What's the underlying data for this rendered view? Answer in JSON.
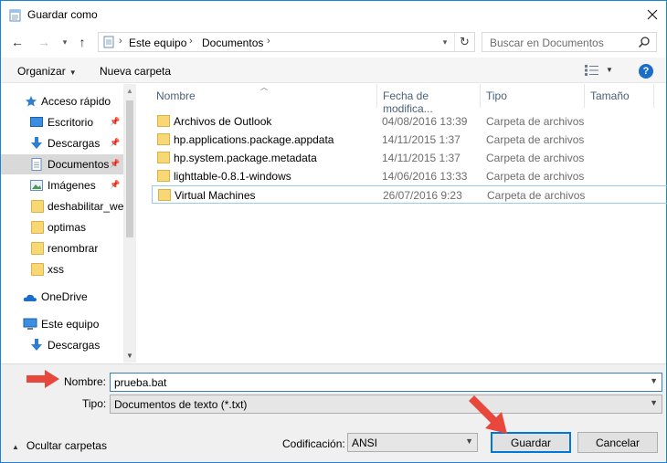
{
  "window": {
    "title": "Guardar como"
  },
  "address": {
    "crumbs": [
      "Este equipo",
      "Documentos"
    ]
  },
  "search": {
    "placeholder": "Buscar en Documentos"
  },
  "commands": {
    "organize": "Organizar",
    "new_folder": "Nueva carpeta"
  },
  "sidebar": {
    "items": [
      {
        "label": "Acceso rápido"
      },
      {
        "label": "Escritorio"
      },
      {
        "label": "Descargas"
      },
      {
        "label": "Documentos"
      },
      {
        "label": "Imágenes"
      },
      {
        "label": "deshabilitar_web"
      },
      {
        "label": "optimas"
      },
      {
        "label": "renombrar"
      },
      {
        "label": "xss"
      },
      {
        "label": "OneDrive"
      },
      {
        "label": "Este equipo"
      },
      {
        "label": "Descargas"
      }
    ]
  },
  "columns": {
    "name": "Nombre",
    "date": "Fecha de modifica...",
    "type": "Tipo",
    "size": "Tamaño"
  },
  "files": [
    {
      "name": "Archivos de Outlook",
      "date": "04/08/2016 13:39",
      "type": "Carpeta de archivos"
    },
    {
      "name": "hp.applications.package.appdata",
      "date": "14/11/2015 1:37",
      "type": "Carpeta de archivos"
    },
    {
      "name": "hp.system.package.metadata",
      "date": "14/11/2015 1:37",
      "type": "Carpeta de archivos"
    },
    {
      "name": "lighttable-0.8.1-windows",
      "date": "14/06/2016 13:33",
      "type": "Carpeta de archivos"
    },
    {
      "name": "Virtual Machines",
      "date": "26/07/2016 9:23",
      "type": "Carpeta de archivos"
    }
  ],
  "form": {
    "name_label": "Nombre:",
    "name_value": "prueba.bat",
    "type_label": "Tipo:",
    "type_value": "Documentos de texto (*.txt)",
    "encoding_label": "Codificación:",
    "encoding_value": "ANSI",
    "hide_folders": "Ocultar carpetas",
    "save": "Guardar",
    "cancel": "Cancelar"
  },
  "colors": {
    "accent": "#0078d7",
    "annotation_arrow": "#e8473c"
  }
}
